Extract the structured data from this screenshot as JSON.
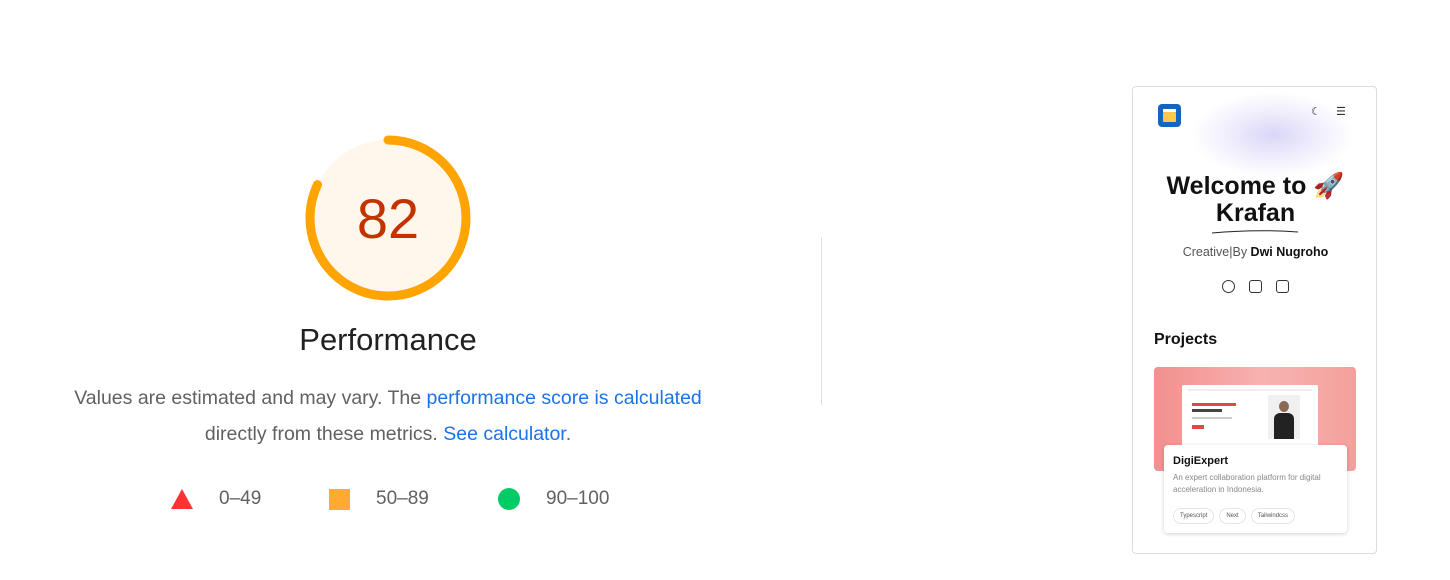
{
  "score": {
    "value": "82",
    "fraction": 0.82,
    "title": "Performance",
    "ring_color": "#ffa400",
    "ring_fill": "#fff7ec",
    "value_color": "#c33300"
  },
  "description": {
    "text_1": "Values are estimated and may vary. The ",
    "link_1": "performance score is calculated",
    "text_2": "directly from these metrics. ",
    "link_2": "See calculator",
    "text_3": "."
  },
  "legend": [
    {
      "label": "0–49",
      "shape": "triangle",
      "color": "#ff3333"
    },
    {
      "label": "50–89",
      "shape": "square",
      "color": "#ffaa33"
    },
    {
      "label": "90–100",
      "shape": "circle",
      "color": "#00cc66"
    }
  ],
  "thumbnail": {
    "header_icons": [
      "moon-icon",
      "menu-icon"
    ],
    "title": "Welcome to 🚀 Krafan",
    "byline_prefix": "Creative|By ",
    "byline_name": "Dwi Nugroho",
    "social_icons": [
      "github-icon",
      "instagram-icon",
      "linkedin-icon"
    ],
    "projects_heading": "Projects",
    "project": {
      "title": "DigiExpert",
      "description": "An expert collaboration platform for digital acceleration in Indonesia.",
      "tags": [
        "Typescript",
        "Next",
        "Tailwindcss"
      ]
    }
  }
}
